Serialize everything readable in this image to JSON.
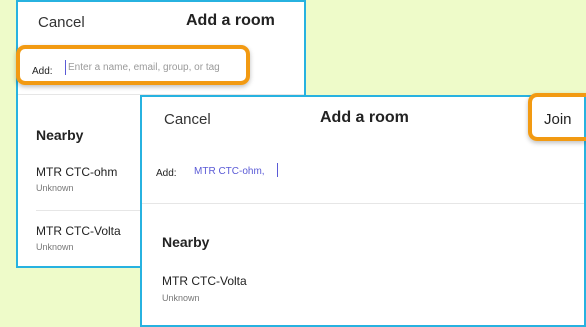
{
  "back_dialog": {
    "cancel_label": "Cancel",
    "title": "Add a room",
    "add_label": "Add:",
    "add_placeholder": "Enter a name, email, group, or tag",
    "nearby_heading": "Nearby",
    "nearby_items": [
      {
        "name": "MTR CTC-ohm",
        "status": "Unknown"
      },
      {
        "name": "MTR CTC-Volta",
        "status": "Unknown"
      }
    ]
  },
  "front_dialog": {
    "cancel_label": "Cancel",
    "title": "Add a room",
    "join_label": "Join",
    "add_label": "Add:",
    "selected_value": "MTR CTC-ohm,",
    "nearby_heading": "Nearby",
    "nearby_items": [
      {
        "name": "MTR CTC-Volta",
        "status": "Unknown"
      }
    ]
  },
  "colors": {
    "background": "#eefbc9",
    "panel_border": "#27b2e0",
    "highlight": "#f29a12",
    "accent_text": "#5a5ad6"
  }
}
